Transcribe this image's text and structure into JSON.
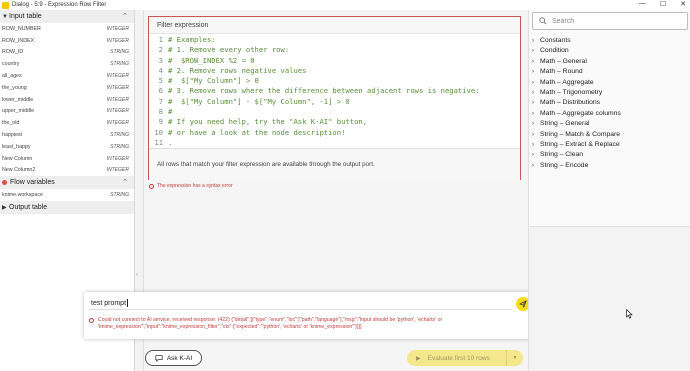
{
  "window": {
    "title": "Dialog - 5:9 - Expression Row Filter",
    "controls": [
      "—",
      "☐",
      "✕"
    ]
  },
  "input_table": {
    "header": "Input table",
    "columns": [
      {
        "name": "ROW_NUMBER",
        "type": "INTEGER"
      },
      {
        "name": "ROW_INDEX",
        "type": "INTEGER"
      },
      {
        "name": "ROW_ID",
        "type": "STRING"
      },
      {
        "name": "country",
        "type": "STRING"
      },
      {
        "name": "all_ages",
        "type": "INTEGER"
      },
      {
        "name": "the_young",
        "type": "INTEGER"
      },
      {
        "name": "lower_middle",
        "type": "INTEGER"
      },
      {
        "name": "upper_middle",
        "type": "INTEGER"
      },
      {
        "name": "the_old",
        "type": "INTEGER"
      },
      {
        "name": "happiest",
        "type": "STRING"
      },
      {
        "name": "least_happy",
        "type": "STRING"
      },
      {
        "name": "New Column",
        "type": "INTEGER"
      },
      {
        "name": "New Column2",
        "type": "INTEGER"
      }
    ]
  },
  "flow_variables": {
    "header": "Flow variables",
    "items": [
      {
        "name": "knime.workspace",
        "type": "STRING"
      }
    ]
  },
  "output_table": {
    "header": "Output table"
  },
  "editor": {
    "title": "Filter expression",
    "lines": [
      {
        "n": "1",
        "text": "# Examples:"
      },
      {
        "n": "2",
        "text": "# 1. Remove every other row:"
      },
      {
        "n": "3",
        "text": "#  $ROW_INDEX %2 = 0"
      },
      {
        "n": "4",
        "text": "# 2. Remove rows negative values"
      },
      {
        "n": "5",
        "text": "#  $[\"My Column\"] > 0"
      },
      {
        "n": "6",
        "text": "# 3. Remove rows where the difference between adjacent rows is negative:"
      },
      {
        "n": "7",
        "text": "#  $[\"My Column\"] - $[\"My Column\", -1] > 0"
      },
      {
        "n": "8",
        "text": "#"
      },
      {
        "n": "9",
        "text": "# If you need help, try the \"Ask K-AI\" button,"
      },
      {
        "n": "10",
        "text": "# or have a look at the node description!"
      },
      {
        "n": "11",
        "text": "."
      }
    ],
    "info": "All rows that match your filter expression are available through the output port.",
    "syntax_error": "The expression has a syntax error"
  },
  "ai": {
    "prompt_value": "test prompt",
    "error": "Could not connect to AI service, received response: (422) {\"detail\":[{\"type\":\"enum\",\"loc\":[\"path\",\"language\"],\"msg\":\"Input should be 'python', 'echarts' or 'knime_expression'\",\"input\":\"knime_expression_filter\",\"ctx\":{\"expected\":\"'python', 'echarts' or 'knime_expression'\"}}]}"
  },
  "buttons": {
    "ask_kai": "Ask K-AI",
    "evaluate": "Evaluate first 10 rows"
  },
  "functions": {
    "search_placeholder": "Search",
    "categories": [
      "Constants",
      "Condition",
      "Math – General",
      "Math – Round",
      "Math – Aggregate",
      "Math – Trigonometry",
      "Math – Distributions",
      "Math – Aggregate columns",
      "String – General",
      "String – Match & Compare",
      "String – Extract & Replace",
      "String – Clean",
      "String – Encode"
    ]
  },
  "colors": {
    "accent_yellow": "#f5dc1a",
    "error_red": "#c23b3b",
    "code_green": "#5a8f3a"
  }
}
